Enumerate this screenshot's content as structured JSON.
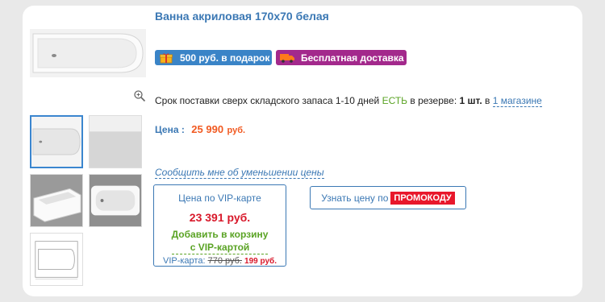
{
  "product": {
    "title": "Ванна акриловая 170х70 белая"
  },
  "badges": {
    "gift": "500 руб. в подарок",
    "delivery": "Бесплатная доставка"
  },
  "stock": {
    "text": "Срок поставки сверх складского запаса 1-10 дней",
    "status": "ЕСТЬ",
    "reserve_label": "в резерве:",
    "quantity": "1 шт.",
    "in": "в",
    "stores_link": "1 магазине"
  },
  "price": {
    "label": "Цена :",
    "value": "25 990",
    "currency": "руб."
  },
  "notify_link": "Сообщить мне об уменьшении цены",
  "vip": {
    "title": "Цена по VIP-карте",
    "price": "23 391 руб.",
    "add_line1": "Добавить в корзину",
    "add_line2": "с VIP-картой",
    "card_label": "VIP-карта:",
    "card_old_price": "770 руб.",
    "card_new_price": "199 руб."
  },
  "promo": {
    "label": "Узнать цену по",
    "tag": "ПРОМОКОДУ"
  },
  "colors": {
    "accent_blue": "#3b78b4",
    "price_orange": "#f15a22",
    "vip_red": "#d8182a",
    "vip_green": "#5aa324",
    "delivery_purple": "#a3298c"
  },
  "icons": {
    "gift": "gift-icon",
    "delivery": "truck-icon",
    "zoom": "zoom-in-icon"
  }
}
